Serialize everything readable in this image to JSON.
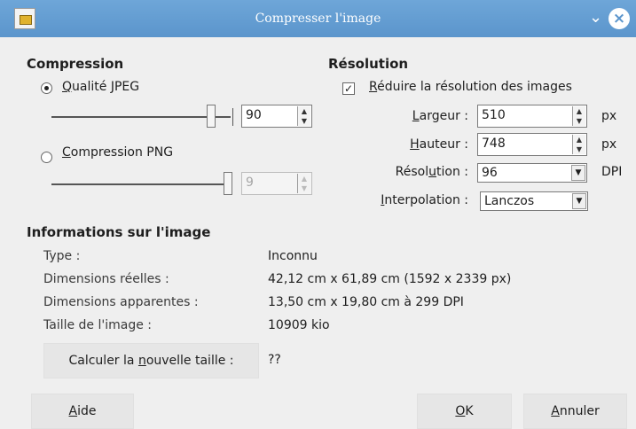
{
  "window": {
    "title": "Compresser l'image"
  },
  "compression": {
    "heading": "Compression",
    "jpeg_label": "Qualité JPEG",
    "jpeg_value": "90",
    "jpeg_level": 0.9,
    "png_label": "Compression PNG",
    "png_value": "9",
    "png_level": 1.0
  },
  "resolution": {
    "heading": "Résolution",
    "reduce_label": "Réduire la résolution des images",
    "reduce_checked": true,
    "width_label": "Largeur :",
    "width_value": "510",
    "width_unit": "px",
    "height_label": "Hauteur :",
    "height_value": "748",
    "height_unit": "px",
    "resolution_label": "Résolution :",
    "resolution_value": "96",
    "resolution_unit": "DPI",
    "interpolation_label": "Interpolation :",
    "interpolation_value": "Lanczos"
  },
  "info": {
    "heading": "Informations sur l'image",
    "rows": [
      {
        "label": "Type :",
        "value": "Inconnu"
      },
      {
        "label": "Dimensions réelles :",
        "value": "42,12 cm x 61,89 cm (1592 x 2339 px)"
      },
      {
        "label": "Dimensions apparentes :",
        "value": "13,50 cm x 19,80 cm à 299 DPI"
      },
      {
        "label": "Taille de l'image :",
        "value": "10909 kio"
      }
    ],
    "calc_button": "Calculer la nouvelle taille :",
    "calc_result": "??"
  },
  "buttons": {
    "help": "Aide",
    "ok": "OK",
    "cancel": "Annuler"
  },
  "icons": {
    "app": "image-compress-icon",
    "minimize": "chevron-down-icon",
    "close": "close-icon"
  }
}
